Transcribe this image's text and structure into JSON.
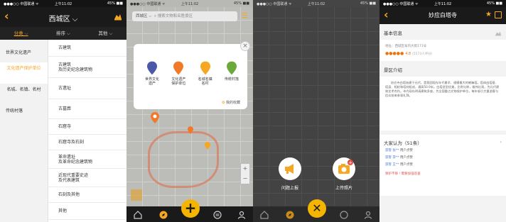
{
  "status_bar": {
    "carrier": "●●●○○ 中国联通 ᯤ",
    "time": "上午11:02",
    "battery": "45% ■■"
  },
  "screen1": {
    "title": "西城区 ⌵",
    "filters": [
      "分类 ⌵",
      "排序 ⌵",
      "其他 ⌵"
    ],
    "left_categories": [
      "世界文化遗产",
      "文化遗产保护单位",
      "名城、名镇、名村",
      "传统村落"
    ],
    "right_items": [
      "古建筑",
      "古建筑\n及历史纪念建筑物",
      "古遗址",
      "古墓葬",
      "石窟寺",
      "石窟寺及石刻",
      "革命遗址\n及革命纪念建筑物",
      "近现代重要史迹\n及代表建筑",
      "石刻及其他",
      "其他"
    ]
  },
  "screen2": {
    "search_location": "西城区 ⌵",
    "search_placeholder": "搜索文物和名胜景区",
    "popup_items": [
      "世界文化\n遗产",
      "文化遗产\n保护单位",
      "名城名镇\n名村",
      "传统村落"
    ],
    "popup_colors": [
      "#4a58a8",
      "#f07a2a",
      "#f5a623",
      "#6aaa3a"
    ],
    "collect_label": "我的收藏"
  },
  "screen3": {
    "action_left": "问题上报",
    "action_right": "上传照片"
  },
  "screen4": {
    "title": "妙应白塔寺",
    "basic_info_header": "基本信息",
    "address": "地址：西城区阜内大街171号",
    "stars": "●●●●●",
    "score": "4.8",
    "rating_count": "(5573人评分)",
    "intro_header": "景区介绍",
    "intro_text": "妙应寺白塔始建于元代，是我国现存年代最早、规模最大的喇嘛塔。塔体由塔基、塔身、相轮和塔刹组成，通高50.9米。白塔造型优美，比例匀称，雄伟壮观，为元代建筑艺术杰作。寺内现存明清建筑多座，为全国重点文物保护单位，每年吸引大量游客与信众前来参观礼拜。",
    "opinion_header": "大家认为（51条）",
    "opinions": [
      {
        "user": "游客 张**",
        "text": "用户点赞"
      },
      {
        "user": "游客 李**",
        "text": "用户点赞"
      },
      {
        "user": "游客 王**",
        "text": "用户点赞"
      }
    ],
    "opinion_footer": "保护不够 ! 需要加强巡查"
  }
}
